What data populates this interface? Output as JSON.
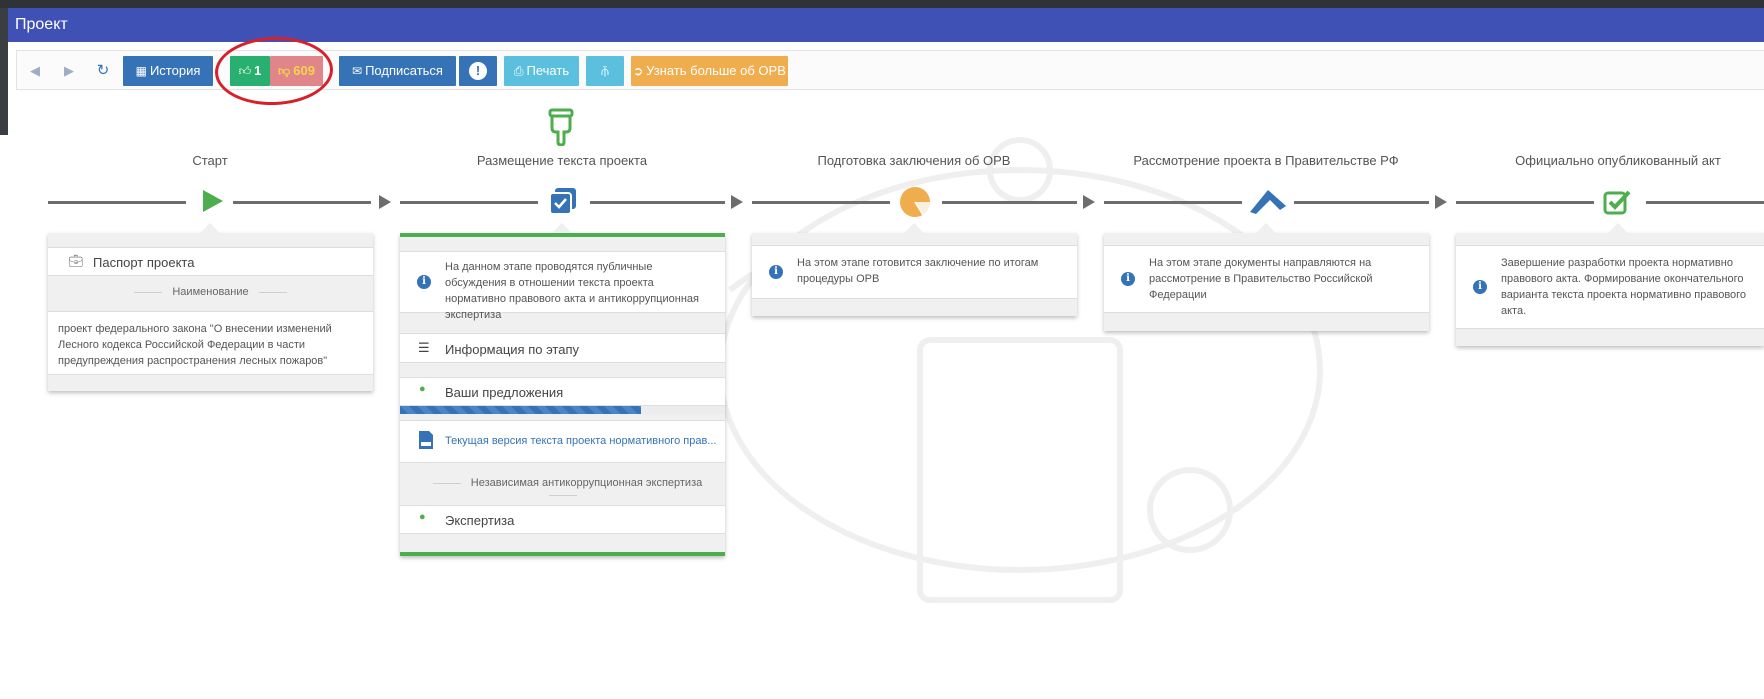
{
  "window": {
    "title": "Проект"
  },
  "toolbar": {
    "back_icon": "arrow-left-circle-icon",
    "forward_icon": "arrow-right-circle-icon",
    "refresh_icon": "refresh-icon",
    "history_label": "История",
    "like_count": "1",
    "dislike_count": "609",
    "subscribe_label": "Подписаться",
    "print_label": "Печать",
    "learn_more_label": "Узнать больше об ОРВ"
  },
  "colors": {
    "titlebar": "#3f51b5",
    "primary": "#3573b6",
    "like": "#27b06f",
    "dislike": "#e0858a",
    "dislike_text": "#f4d54a",
    "print": "#5bc0de",
    "orange": "#f0ad4e",
    "green_accent": "#4cae4c"
  },
  "stages": [
    {
      "title": "Старт",
      "icon": "play-icon"
    },
    {
      "title": "Размещение текста проекта",
      "icon": "checkbox-icon"
    },
    {
      "title": "Подготовка заключения об ОРВ",
      "icon": "pie-chart-icon"
    },
    {
      "title": "Рассмотрение проекта в Правительстве РФ",
      "icon": "chevron-up-icon"
    },
    {
      "title": "Официально опубликованный акт",
      "icon": "check-square-icon"
    }
  ],
  "start_card": {
    "passport_label": "Паспорт проекта",
    "name_header": "Наименование",
    "name_value": "проект федерального закона \"О внесении изменений Лесного кодекса Российской Федерации в части предупреждения распространения лесных пожаров\""
  },
  "placement_card": {
    "info": "На данном этапе проводятся публичные обсуждения в отношении текста проекта нормативно правового акта и антикоррупционная экспертиза",
    "stage_info_label": "Информация по этапу",
    "proposals_label": "Ваши предложения",
    "proposals_progress": 0.74,
    "doc_link": "Текущая версия текста проекта нормативного прав...",
    "anticorruption_header": "Независимая антикоррупционная экспертиза",
    "expertise_label": "Экспертиза"
  },
  "orv_card": {
    "info": "На этом этапе готовится заключение по итогам процедуры ОРВ"
  },
  "gov_card": {
    "info": "На этом этапе документы направляются на рассмотрение в Правительство Российской Федерации"
  },
  "act_card": {
    "info": "Завершение разработки проекта нормативно правового акта. Формирование окончательного варианта текста проекта нормативно правового акта."
  }
}
